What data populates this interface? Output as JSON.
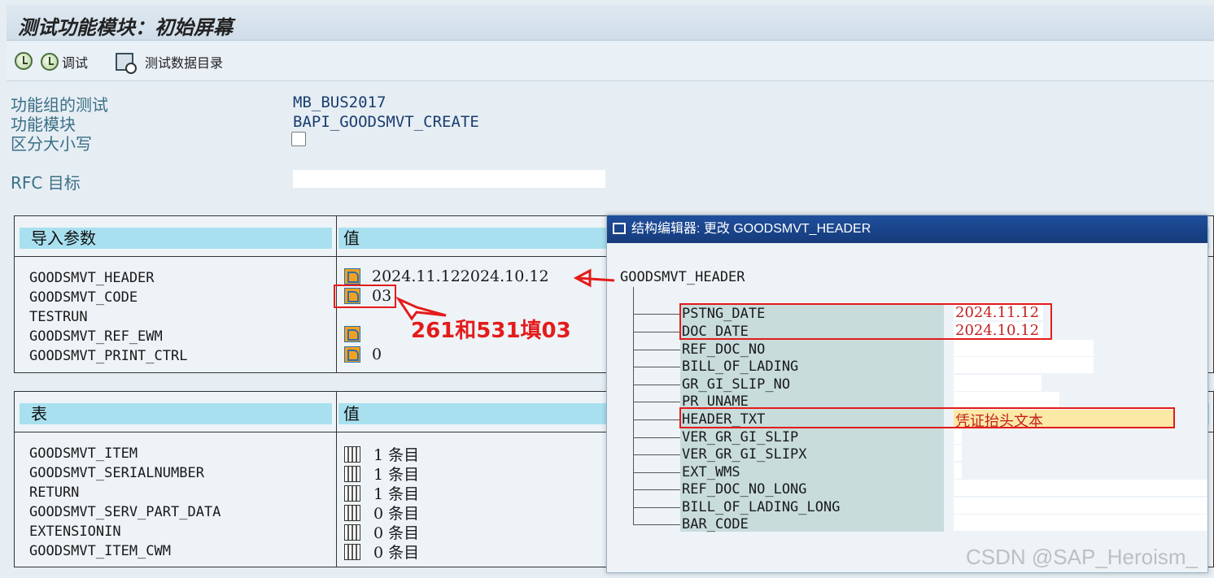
{
  "title": "测试功能模块：初始屏幕",
  "toolbar": {
    "debug_label": "调试",
    "test_data_label": "测试数据目录"
  },
  "form": {
    "func_group_label": "功能组的测试",
    "func_group_value": "MB_BUS2017",
    "func_module_label": "功能模块",
    "func_module_value": "BAPI_GOODSMVT_CREATE",
    "case_label": "区分大小写",
    "rfc_label": "RFC 目标",
    "rfc_value": ""
  },
  "import_params": {
    "header": "导入参数",
    "value_header": "值",
    "rows": [
      {
        "name": "GOODSMVT_HEADER",
        "value": "2024.11.122024.10.12",
        "icon": "structure-icon"
      },
      {
        "name": "GOODSMVT_CODE",
        "value": "03",
        "icon": "structure-icon"
      },
      {
        "name": "TESTRUN",
        "value": "",
        "icon": ""
      },
      {
        "name": "GOODSMVT_REF_EWM",
        "value": "",
        "icon": "structure-icon"
      },
      {
        "name": "GOODSMVT_PRINT_CTRL",
        "value": "0",
        "icon": "structure-icon"
      }
    ]
  },
  "tables": {
    "header": "表",
    "value_header": "值",
    "rows": [
      {
        "name": "GOODSMVT_ITEM",
        "value": "1 条目"
      },
      {
        "name": "GOODSMVT_SERIALNUMBER",
        "value": "1 条目"
      },
      {
        "name": "RETURN",
        "value": "1 条目"
      },
      {
        "name": "GOODSMVT_SERV_PART_DATA",
        "value": "0 条目"
      },
      {
        "name": "EXTENSIONIN",
        "value": "0 条目"
      },
      {
        "name": "GOODSMVT_ITEM_CWM",
        "value": "0 条目"
      }
    ]
  },
  "annotation": "261和531填03",
  "popup": {
    "title": "结构编辑器: 更改 GOODSMVT_HEADER",
    "root": "GOODSMVT_HEADER",
    "fields": [
      {
        "name": "PSTNG_DATE",
        "value": "2024.11.12"
      },
      {
        "name": "DOC_DATE",
        "value": "2024.10.12"
      },
      {
        "name": "REF_DOC_NO",
        "value": ""
      },
      {
        "name": "BILL_OF_LADING",
        "value": ""
      },
      {
        "name": "GR_GI_SLIP_NO",
        "value": ""
      },
      {
        "name": "PR_UNAME",
        "value": ""
      },
      {
        "name": "HEADER_TXT",
        "value": "凭证抬头文本"
      },
      {
        "name": "VER_GR_GI_SLIP",
        "value": ""
      },
      {
        "name": "VER_GR_GI_SLIPX",
        "value": ""
      },
      {
        "name": "EXT_WMS",
        "value": ""
      },
      {
        "name": "REF_DOC_NO_LONG",
        "value": ""
      },
      {
        "name": "BILL_OF_LADING_LONG",
        "value": ""
      },
      {
        "name": "BAR_CODE",
        "value": ""
      }
    ]
  },
  "watermark": "CSDN @SAP_Heroism_",
  "colors": {
    "accent_red": "#e41b1b",
    "header_cyan": "#a8e0f0",
    "popup_title_blue": "#1f4f9d"
  }
}
